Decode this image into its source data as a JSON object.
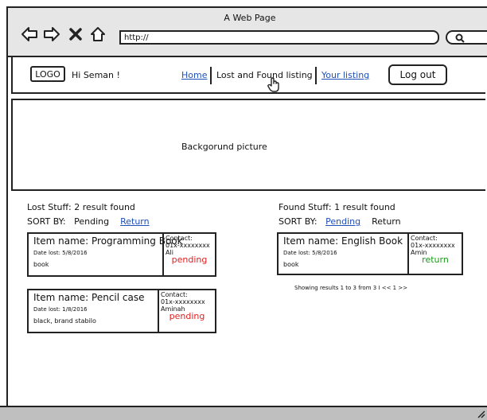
{
  "window": {
    "title": "A Web Page"
  },
  "browser": {
    "url": "http://",
    "icons": [
      "back-arrow-icon",
      "forward-arrow-icon",
      "close-x-icon",
      "home-icon",
      "search-icon"
    ]
  },
  "header": {
    "logo": "LOGO",
    "greeting": "Hi Seman !",
    "nav": {
      "home": "Home",
      "lost_found": "Lost and Found listing",
      "your_listing": "Your listing"
    },
    "logout": "Log out"
  },
  "hero": {
    "text": "Backgorund picture"
  },
  "lost": {
    "title": "Lost Stuff: 2 result found",
    "sort_label": "SORT BY:",
    "sort_options": [
      "Pending",
      "Return"
    ],
    "items": [
      {
        "name": "Item name: Programming Book",
        "date": "Date lost: 5/8/2016",
        "desc": "book",
        "contact_label": "Contact:",
        "phone": "01x-xxxxxxxx",
        "person": "Ali",
        "status": "pending"
      },
      {
        "name": "Item name: Pencil case",
        "date": "Date lost: 1/8/2016",
        "desc": "black, brand stabilo",
        "contact_label": "Contact:",
        "phone": "01x-xxxxxxxx",
        "person": "Aminah",
        "status": "pending"
      }
    ]
  },
  "found": {
    "title": "Found Stuff: 1 result found",
    "sort_label": "SORT BY:",
    "sort_options": [
      "Pending",
      "Return"
    ],
    "items": [
      {
        "name": "Item name: English Book",
        "date": "Date lost: 5/8/2016",
        "desc": "book",
        "contact_label": "Contact:",
        "phone": "01x-xxxxxxxx",
        "person": "Amin",
        "status": "return"
      }
    ],
    "paging": "Showing results 1 to 3 from 3  I  <<  1  >>"
  },
  "colors": {
    "link": "#1f4fb8",
    "pending": "#e02020",
    "return": "#1a9a1a"
  }
}
